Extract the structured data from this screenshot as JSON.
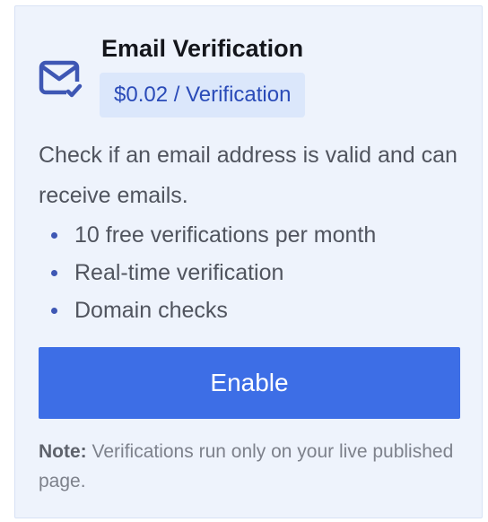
{
  "card": {
    "title": "Email Verification",
    "price": "$0.02 / Verification",
    "icon": "mail-check-icon",
    "description": "Check if an email address is valid and can receive emails.",
    "features": [
      "10 free verifications per month",
      "Real-time verification",
      "Domain checks"
    ],
    "enable_label": "Enable",
    "note_label": "Note:",
    "note_text": "Verifications run only on your live published page."
  },
  "colors": {
    "card_background": "#eef3fc",
    "accent": "#3d6ee6",
    "badge_background": "#dbe7fb",
    "badge_text": "#2a4bb8",
    "icon": "#3e57b4"
  }
}
